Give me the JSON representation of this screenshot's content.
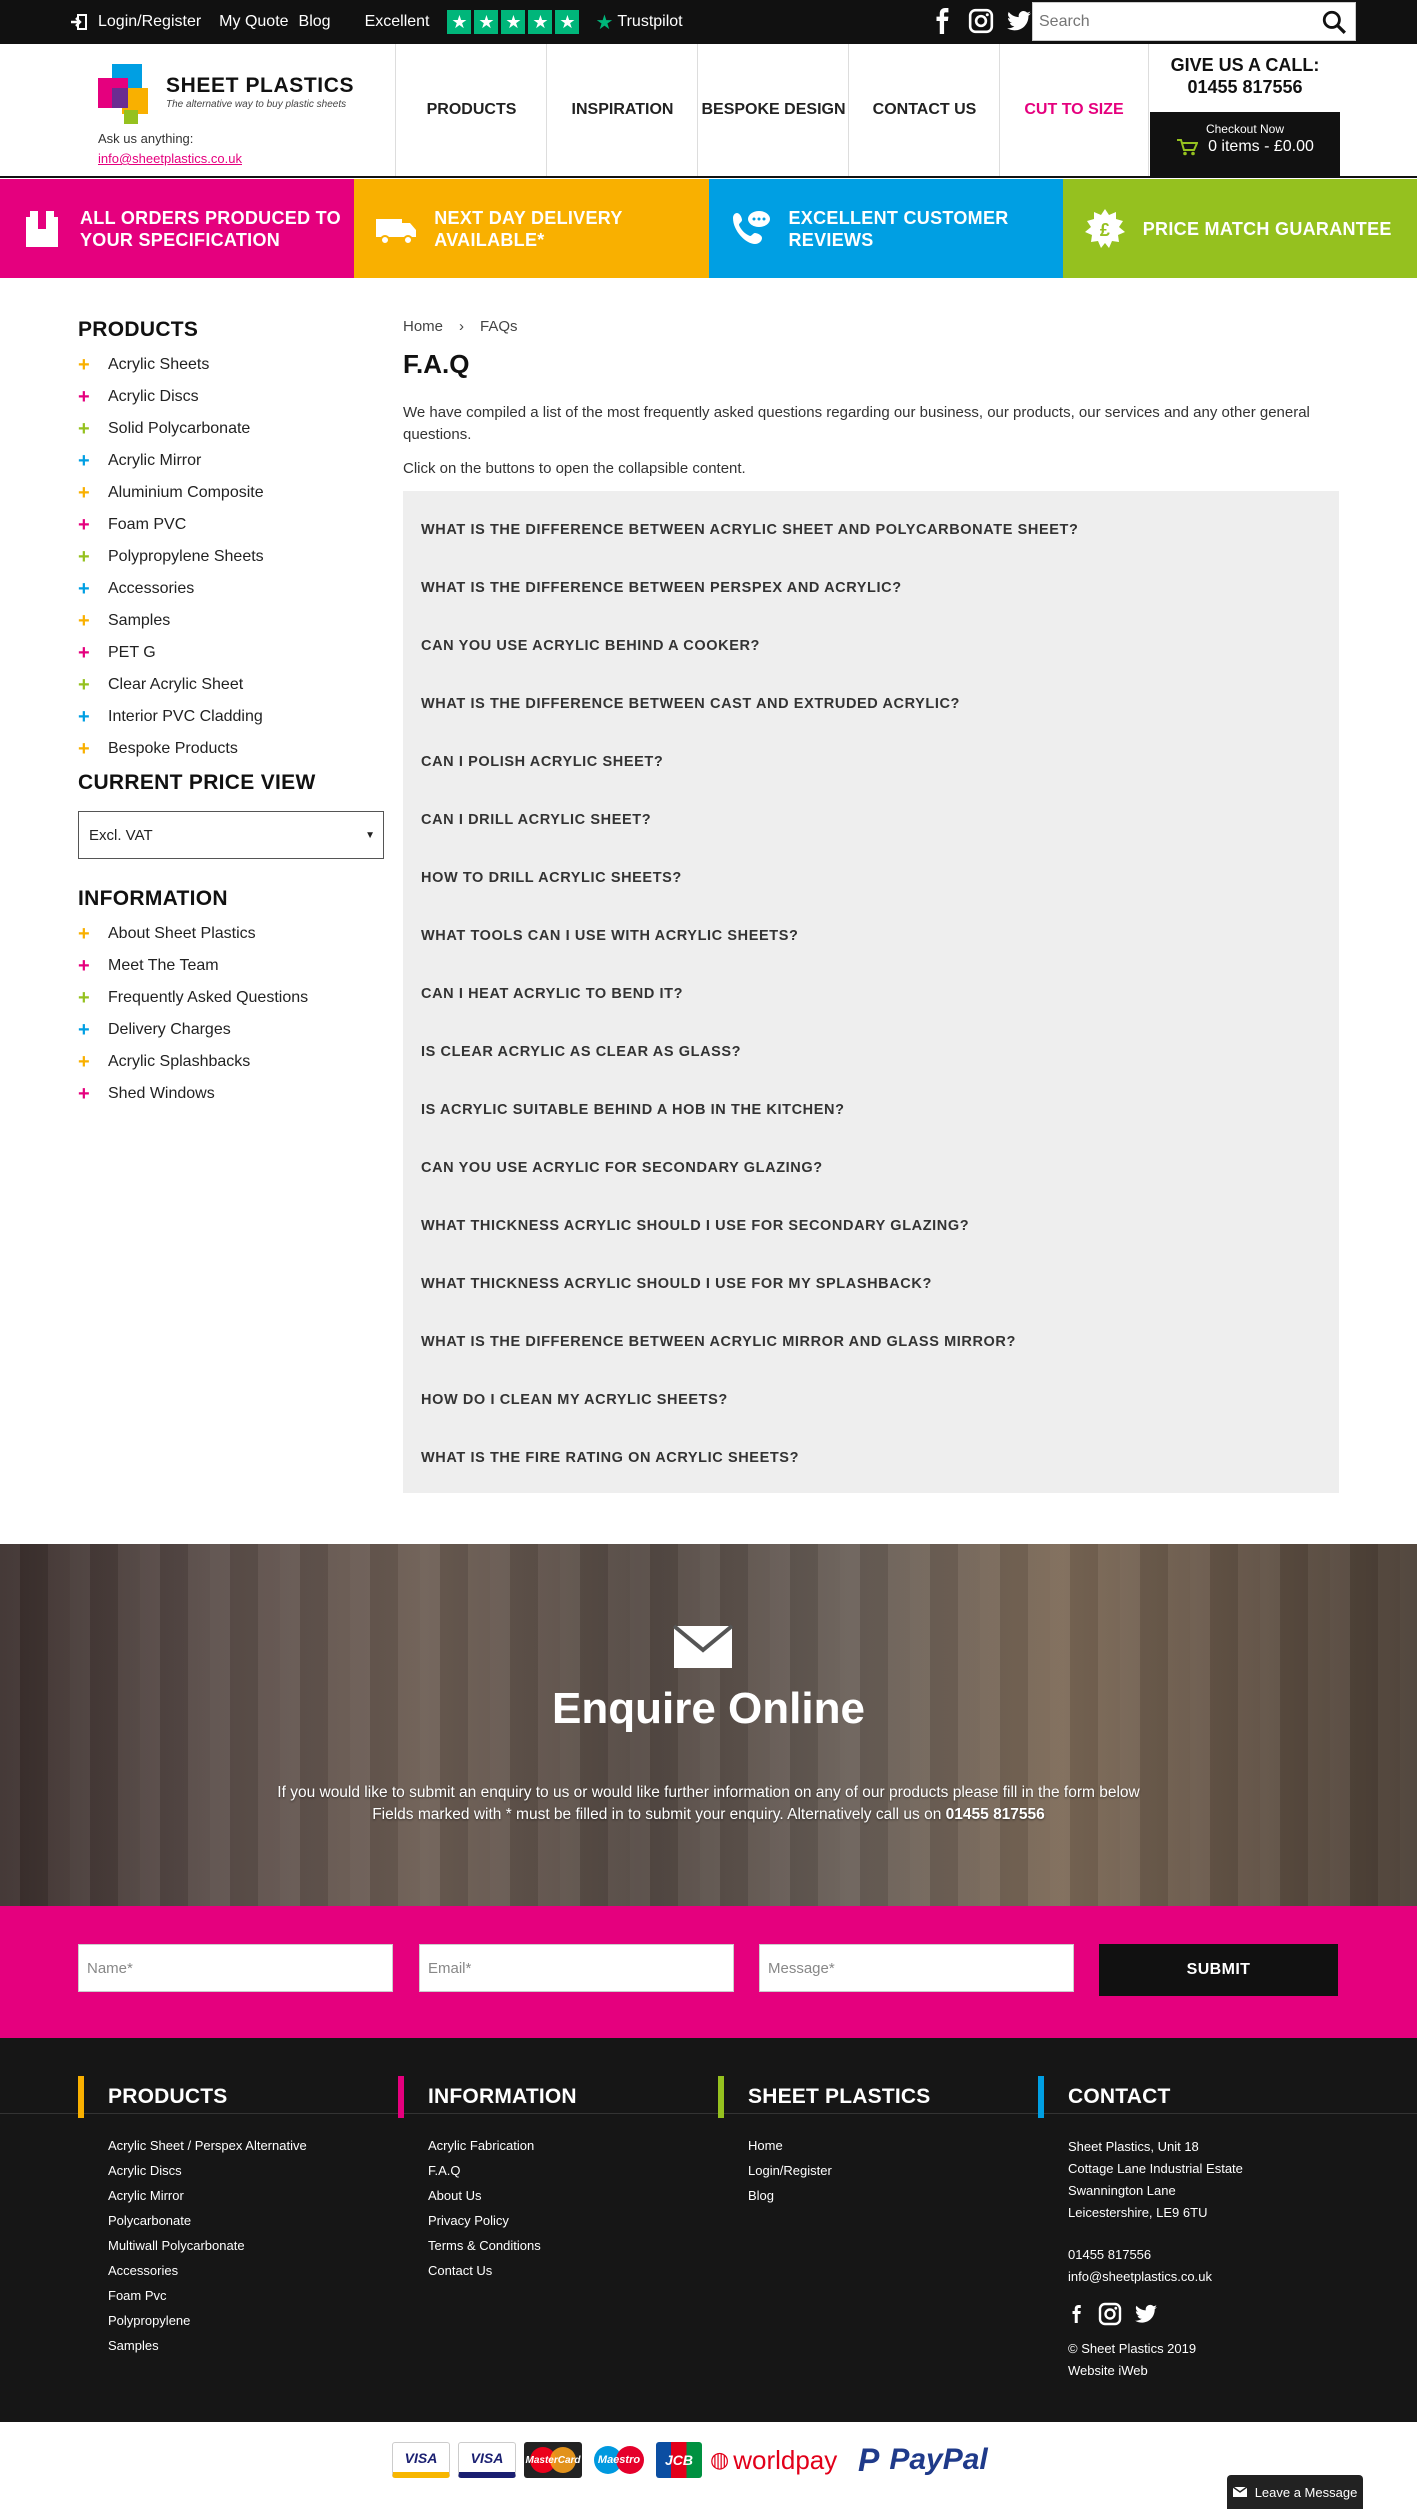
{
  "topbar": {
    "login": "Login/Register",
    "quote": "My Quote",
    "blog": "Blog",
    "rating_word": "Excellent",
    "trustpilot": "Trustpilot",
    "search_placeholder": "Search",
    "brand_color": "#00b67a"
  },
  "header": {
    "brand": "SHEET PLASTICS",
    "tagline": "The alternative way to buy plastic sheets",
    "ask": "Ask us anything:",
    "email": "info@sheetplastics.co.uk",
    "nav": [
      "PRODUCTS",
      "INSPIRATION",
      "BESPOKE DESIGN",
      "CONTACT US",
      "CUT TO SIZE"
    ],
    "call_label": "GIVE US A CALL:",
    "phone": "01455 817556",
    "cart_label": "Checkout Now",
    "cart_value": "0 items - £0.00",
    "accent": "#e5007e"
  },
  "banners": [
    {
      "text": "ALL ORDERS PRODUCED TO YOUR SPECIFICATION",
      "color": "#e5007e",
      "icon": "box-icon"
    },
    {
      "text": "NEXT DAY DELIVERY AVAILABLE*",
      "color": "#f9b000",
      "icon": "truck-icon"
    },
    {
      "text": "EXCELLENT CUSTOMER REVIEWS",
      "color": "#009fe3",
      "icon": "phone-chat-icon"
    },
    {
      "text": "PRICE MATCH GUARANTEE",
      "color": "#95c11f",
      "icon": "pound-badge-icon"
    }
  ],
  "sidebar": {
    "products_title": "PRODUCTS",
    "products": [
      "Acrylic Sheets",
      "Acrylic Discs",
      "Solid Polycarbonate",
      "Acrylic Mirror",
      "Aluminium Composite",
      "Foam PVC",
      "Polypropylene Sheets",
      "Accessories",
      "Samples",
      "PET G",
      "Clear Acrylic Sheet",
      "Interior PVC Cladding",
      "Bespoke Products"
    ],
    "price_title": "CURRENT PRICE VIEW",
    "price_value": "Excl. VAT",
    "info_title": "INFORMATION",
    "info": [
      "About Sheet Plastics",
      "Meet The Team",
      "Frequently Asked Questions",
      "Delivery Charges",
      "Acrylic Splashbacks",
      "Shed Windows"
    ]
  },
  "main": {
    "crumb_home": "Home",
    "crumb_sep": "›",
    "crumb_current": "FAQs",
    "title": "F.A.Q",
    "intro": "We have compiled a list of the most frequently asked questions regarding our business, our products, our services and any other general questions.",
    "instruction": "Click on the buttons to open the collapsible content.",
    "faqs": [
      "WHAT IS THE DIFFERENCE BETWEEN ACRYLIC SHEET AND POLYCARBONATE SHEET?",
      "WHAT IS THE DIFFERENCE BETWEEN PERSPEX AND ACRYLIC?",
      "CAN YOU USE ACRYLIC BEHIND A COOKER?",
      "WHAT IS THE DIFFERENCE BETWEEN CAST AND EXTRUDED ACRYLIC?",
      "CAN I POLISH ACRYLIC SHEET?",
      "CAN I DRILL ACRYLIC SHEET?",
      "HOW TO DRILL ACRYLIC SHEETS?",
      "WHAT TOOLS CAN I USE WITH ACRYLIC SHEETS?",
      "CAN I HEAT ACRYLIC TO BEND IT?",
      "IS CLEAR ACRYLIC AS CLEAR AS GLASS?",
      "IS ACRYLIC SUITABLE BEHIND A HOB IN THE KITCHEN?",
      "CAN YOU USE ACRYLIC FOR SECONDARY GLAZING?",
      "WHAT THICKNESS ACRYLIC SHOULD I USE FOR SECONDARY GLAZING?",
      "WHAT THICKNESS ACRYLIC SHOULD I USE FOR MY SPLASHBACK?",
      "WHAT IS THE DIFFERENCE BETWEEN ACRYLIC MIRROR AND GLASS MIRROR?",
      "HOW DO I CLEAN MY ACRYLIC SHEETS?",
      "WHAT IS THE FIRE RATING ON ACRYLIC SHEETS?"
    ]
  },
  "enquire": {
    "title": "Enquire Online",
    "line1": "If you would like to submit an enquiry to us or would like further information on any of our products please fill in the form below",
    "line2_prefix": "Fields marked with * must be filled in to submit your enquiry. Alternatively call us on",
    "line2_phone": "01455 817556"
  },
  "form": {
    "name_placeholder": "Name*",
    "email_placeholder": "Email*",
    "message_placeholder": "Message*",
    "submit": "SUBMIT"
  },
  "footer": {
    "products_title": "PRODUCTS",
    "products": [
      "Acrylic Sheet / Perspex Alternative",
      "Acrylic Discs",
      "Acrylic Mirror",
      "Polycarbonate",
      "Multiwall Polycarbonate",
      "Accessories",
      "Foam Pvc",
      "Polypropylene",
      "Samples"
    ],
    "info_title": "INFORMATION",
    "info": [
      "Acrylic Fabrication",
      "F.A.Q",
      "About Us",
      "Privacy Policy",
      "Terms & Conditions",
      "Contact Us"
    ],
    "sp_title": "SHEET PLASTICS",
    "sp": [
      "Home",
      "Login/Register",
      "Blog"
    ],
    "contact_title": "CONTACT",
    "address": [
      "Sheet Plastics, Unit 18",
      "Cottage Lane Industrial Estate",
      "Swannington Lane",
      "Leicestershire, LE9 6TU"
    ],
    "phone": "01455 817556",
    "email": "info@sheetplastics.co.uk",
    "copyright": "© Sheet Plastics 2019",
    "credit": "Website iWeb"
  },
  "payments": [
    "VISA",
    "VISA",
    "MasterCard",
    "Maestro",
    "JCB",
    "worldpay",
    "PayPal"
  ],
  "chat": "Leave a Message"
}
